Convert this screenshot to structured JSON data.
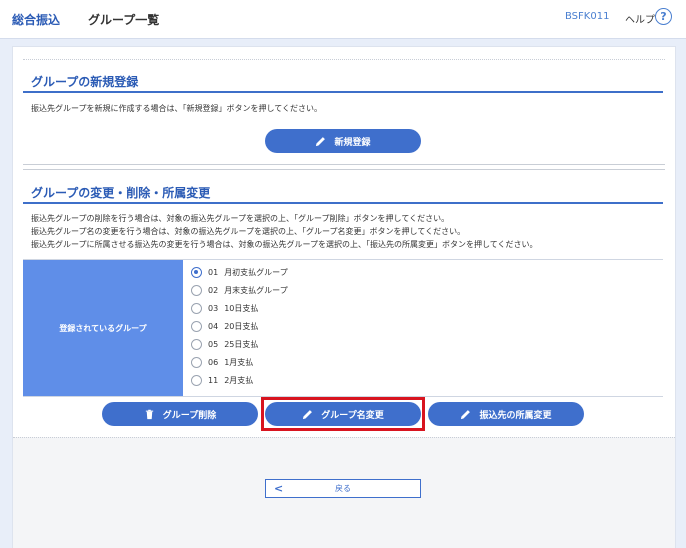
{
  "header": {
    "app_title": "総合振込",
    "page_title": "グループ一覧",
    "screen_id": "BSFK011",
    "help_label": "ヘルプ",
    "help_icon": "?"
  },
  "new_section": {
    "title": "グループの新規登録",
    "description": "振込先グループを新規に作成する場合は、「新規登録」ボタンを押してください。",
    "button_label": "新規登録"
  },
  "edit_section": {
    "title": "グループの変更・削除・所属変更",
    "descriptions": [
      "振込先グループの削除を行う場合は、対象の振込先グループを選択の上、「グループ削除」ボタンを押してください。",
      "振込先グループ名の変更を行う場合は、対象の振込先グループを選択の上、「グループ名変更」ボタンを押してください。",
      "振込先グループに所属させる振込先の変更を行う場合は、対象の振込先グループを選択の上、「振込先の所属変更」ボタンを押してください。"
    ],
    "groups_label": "登録されているグループ",
    "groups": [
      {
        "code": "01",
        "name": "月初支払グループ",
        "selected": true
      },
      {
        "code": "02",
        "name": "月末支払グループ",
        "selected": false
      },
      {
        "code": "03",
        "name": "10日支払",
        "selected": false
      },
      {
        "code": "04",
        "name": "20日支払",
        "selected": false
      },
      {
        "code": "05",
        "name": "25日支払",
        "selected": false
      },
      {
        "code": "06",
        "name": "1月支払",
        "selected": false
      },
      {
        "code": "11",
        "name": "2月支払",
        "selected": false
      }
    ],
    "buttons": {
      "delete": "グループ削除",
      "rename": "グループ名変更",
      "membership": "振込先の所属変更"
    }
  },
  "footer": {
    "back_label": "戻る"
  },
  "colors": {
    "accent": "#3f6fcc",
    "label_bg": "#5f8ee8",
    "highlight": "#d8141f"
  }
}
